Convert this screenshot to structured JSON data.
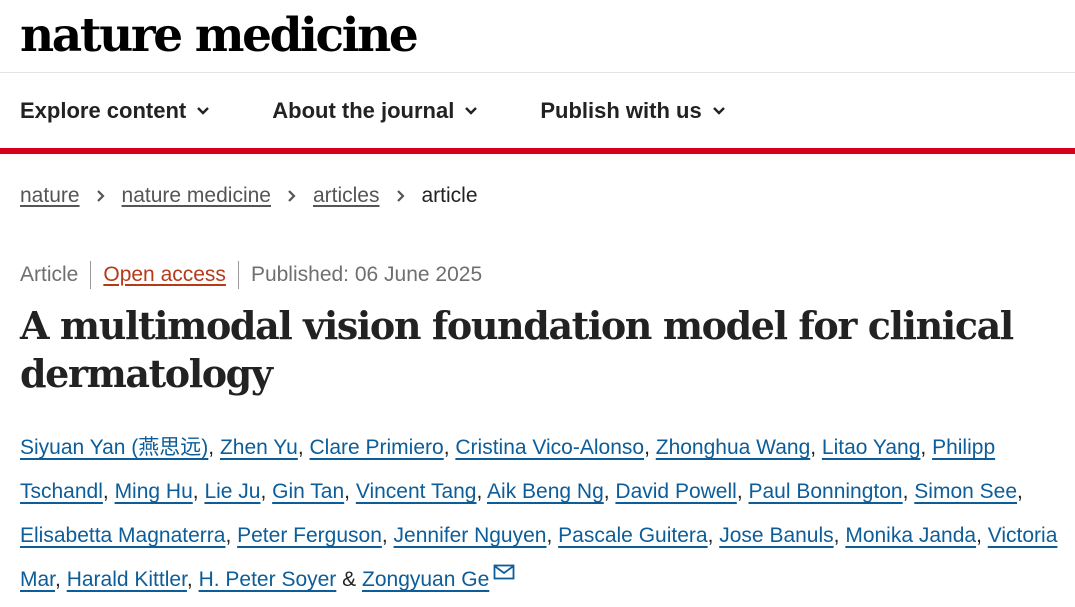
{
  "header": {
    "logo_text": "nature medicine"
  },
  "nav": {
    "items": [
      {
        "label": "Explore content",
        "icon": "chevron-down-icon"
      },
      {
        "label": "About the journal",
        "icon": "chevron-down-icon"
      },
      {
        "label": "Publish with us",
        "icon": "chevron-down-icon"
      }
    ]
  },
  "breadcrumb": {
    "items": [
      "nature",
      "nature medicine",
      "articles"
    ],
    "current": "article"
  },
  "article": {
    "type": "Article",
    "access": "Open access",
    "published": "Published: 06 June 2025",
    "title": "A multimodal vision foundation model for clinical dermatology"
  },
  "authors": {
    "list": [
      "Siyuan Yan (燕思远)",
      "Zhen Yu",
      "Clare Primiero",
      "Cristina Vico-Alonso",
      "Zhonghua Wang",
      "Litao Yang",
      "Philipp Tschandl",
      "Ming Hu",
      "Lie Ju",
      "Gin Tan",
      "Vincent Tang",
      "Aik Beng Ng",
      "David Powell",
      "Paul Bonnington",
      "Simon See",
      "Elisabetta Magnaterra",
      "Peter Ferguson",
      "Jennifer Nguyen",
      "Pascale Guitera",
      "Jose Banuls",
      "Monika Janda",
      "Victoria Mar",
      "Harald Kittler",
      "H. Peter Soyer"
    ],
    "conjunction": "&",
    "last": "Zongyuan Ge",
    "last_icon": "mail-icon"
  },
  "colors": {
    "accent_red": "#d5001c",
    "link_blue": "#0c5d99",
    "open_access": "#b43a1a"
  }
}
